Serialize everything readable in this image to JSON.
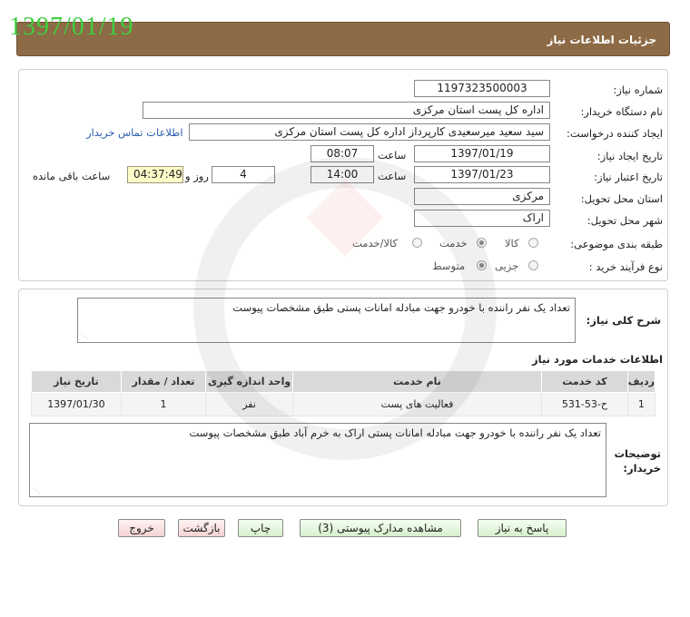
{
  "date_stamp": "1397/01/19",
  "header": {
    "title": "جزئیات اطلاعات نیاز"
  },
  "details": {
    "need_number_label": "شماره نیاز:",
    "need_number": "1197323500003",
    "buyer_org_label": "نام دستگاه خریدار:",
    "buyer_org": "اداره کل پست استان مرکزی",
    "creator_label": "ایجاد کننده درخواست:",
    "creator": "سید سعید میرسعیدی کارپرداز اداره کل پست استان مرکزی",
    "buyer_contact_link": "اطلاعات تماس خریدار",
    "created_date_label": "تاریخ ایجاد نیاز:",
    "created_date": "1397/01/19",
    "time_label": "ساعت",
    "created_time": "08:07",
    "validity_date_label": "تاریخ اعتبار نیاز:",
    "validity_date": "1397/01/23",
    "validity_time": "14:00",
    "days_remaining": "4",
    "days_and_label": "روز و",
    "countdown": "04:37:49",
    "remaining_label": "ساعت باقی مانده",
    "province_label": "استان محل تحویل:",
    "province": "مرکزی",
    "city_label": "شهر محل تحویل:",
    "city": "اراک",
    "category_label": "طبقه بندی موضوعی:",
    "category_options": [
      "کالا",
      "خدمت",
      "کالا/خدمت"
    ],
    "category_selected": "خدمت",
    "process_label": "نوع فرآیند خرید :",
    "process_options": [
      "جزیی",
      "متوسط"
    ],
    "process_selected": "متوسط"
  },
  "summary": {
    "label": "شرح کلی نیاز:",
    "text": "تعداد یک نفر راننده با خودرو جهت مبادله  امانات پستی طبق مشخصات پیوست"
  },
  "services": {
    "section_title": "اطلاعات خدمات مورد نیاز",
    "columns": [
      "ردیف",
      "کد خدمت",
      "نام خدمت",
      "واحد اندازه گیری",
      "تعداد / مقدار",
      "تاریخ نیاز"
    ],
    "rows": [
      {
        "index": "1",
        "code": "ح-53-531",
        "name": "فعالیت های پست",
        "unit": "نفر",
        "qty": "1",
        "date": "1397/01/30"
      }
    ]
  },
  "buyer_notes": {
    "label": "توضیحات خریدار:",
    "text": "تعداد یک نفر راننده با خودرو جهت مبادله  امانات پستی اراک به خرم آباد طبق مشخصات پیوست"
  },
  "buttons": {
    "reply": "پاسخ به نیاز",
    "view_docs": "مشاهده مدارک پیوستی (3)",
    "print": "چاپ",
    "back": "بازگشت",
    "exit": "خروج"
  }
}
